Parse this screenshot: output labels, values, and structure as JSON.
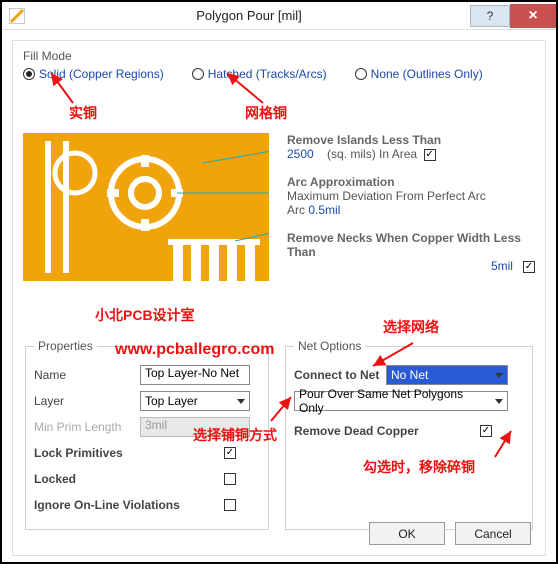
{
  "window": {
    "title": "Polygon Pour [mil]"
  },
  "fillmode": {
    "label": "Fill Mode",
    "opts": {
      "solid": "Solid (Copper Regions)",
      "hatched": "Hatched (Tracks/Arcs)",
      "none": "None (Outlines Only)"
    }
  },
  "right": {
    "islands": {
      "title": "Remove Islands Less Than",
      "value": "2500",
      "unit": "(sq. mils)  In Area"
    },
    "arc": {
      "title": "Arc Approximation",
      "sub": "Maximum Deviation From Perfect Arc",
      "value": "0.5mil"
    },
    "necks": {
      "title": "Remove Necks When Copper Width Less Than",
      "value": "5mil"
    }
  },
  "properties": {
    "legend": "Properties",
    "name_label": "Name",
    "name_value": "Top Layer-No Net",
    "layer_label": "Layer",
    "layer_value": "Top Layer",
    "minprim_label": "Min Prim Length",
    "minprim_value": "3mil",
    "lockprim_label": "Lock Primitives",
    "locked_label": "Locked",
    "ignore_label": "Ignore On-Line Violations"
  },
  "netopts": {
    "legend": "Net Options",
    "connect_label": "Connect to Net",
    "connect_value": "No Net",
    "pour_value": "Pour Over Same Net Polygons Only",
    "remove_dead_label": "Remove Dead Copper"
  },
  "buttons": {
    "ok": "OK",
    "cancel": "Cancel"
  },
  "annotations": {
    "solid": "实铜",
    "hatched": "网格铜",
    "watermark1": "小北PCB设计室",
    "watermark2": "www.pcballegro.com",
    "pour_way": "选择铺铜方式",
    "select_net": "选择网络",
    "dead_note": "勾选时，移除碎铜"
  }
}
